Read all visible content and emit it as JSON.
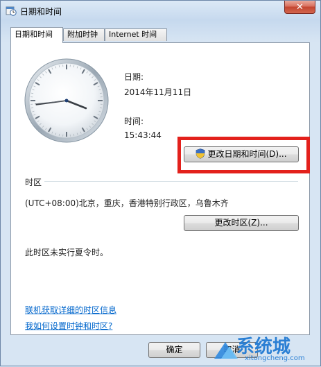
{
  "window": {
    "title": "日期和时间",
    "close_glyph": "✕"
  },
  "tabs": [
    {
      "label": "日期和时间",
      "active": true
    },
    {
      "label": "附加时钟",
      "active": false
    },
    {
      "label": "Internet 时间",
      "active": false
    }
  ],
  "datetime": {
    "date_label": "日期:",
    "date_value": "2014年11月11日",
    "time_label": "时间:",
    "time_value": "15:43:44",
    "change_button": "更改日期和时间(D)..."
  },
  "timezone": {
    "section_label": "时区",
    "current": "(UTC+08:00)北京，重庆，香港特别行政区，乌鲁木齐",
    "change_button": "更改时区(Z)...",
    "dst_note": "此时区未实行夏令时。"
  },
  "links": {
    "online_info": "联机获取详细的时区信息",
    "how_to": "我如何设置时钟和时区?"
  },
  "footer": {
    "ok_button": "确定",
    "cancel_button": "取消"
  },
  "clock": {
    "hour": 15,
    "minute": 43,
    "second": 44
  },
  "watermark": {
    "text": "系统城",
    "url": "xitongcheng.com"
  },
  "colors": {
    "highlight_border": "#e3211c",
    "link": "#0066cc"
  }
}
